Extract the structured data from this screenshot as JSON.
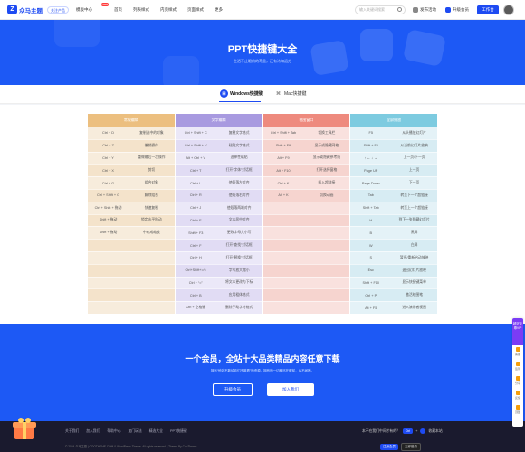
{
  "nav": {
    "logo_mark": "Z",
    "logo_text": "众马主题",
    "badge": "关注产品",
    "items": [
      {
        "label": "模板中心",
        "hot": "HOT"
      },
      {
        "label": "首页"
      },
      {
        "label": "列表样式"
      },
      {
        "label": "内页样式"
      },
      {
        "label": "页面样式"
      },
      {
        "label": "更多"
      }
    ],
    "search_placeholder": "输入关键词搜索",
    "right": [
      {
        "label": "发布活动"
      },
      {
        "label": "升级会员"
      }
    ],
    "work_button": "工作台"
  },
  "hero": {
    "title": "PPT快捷键大全",
    "subtitle": "生活不止眼前的苟且，还有诗和远方"
  },
  "tabs": [
    {
      "label": "Windows快捷键",
      "icon": "⊞"
    },
    {
      "label": "Mac快捷键",
      "icon": "⌘"
    }
  ],
  "columns": [
    {
      "title": "常规编辑",
      "color": "#ecbf7f",
      "rows": [
        [
          "Ctrl + D",
          "复制选中的对象"
        ],
        [
          "Ctrl + Z",
          "撤销操作"
        ],
        [
          "Ctrl + Y",
          "重做最后一次操作"
        ],
        [
          "Ctrl + X",
          "剪切"
        ],
        [
          "Ctrl + G",
          "组合对象"
        ],
        [
          "Ctrl + Shift + G",
          "解除组合"
        ],
        [
          "Ctrl + Shift + 拖动",
          "快速复制"
        ],
        [
          "Shift + 拖动",
          "锁定水平移动"
        ],
        [
          "Shift + 拖动",
          "中心成缩放"
        ],
        [
          "",
          ""
        ],
        [
          "",
          ""
        ],
        [
          "",
          ""
        ],
        [
          "",
          ""
        ],
        [
          "",
          ""
        ],
        [
          "",
          ""
        ]
      ]
    },
    {
      "title": "文字编辑",
      "color": "#a89ae0",
      "rows": [
        [
          "Ctrl + Shift + C",
          "复制文字格式"
        ],
        [
          "Ctrl + Shift + V",
          "粘贴文字格式"
        ],
        [
          "Alt + Ctrl + V",
          "选择性粘贴"
        ],
        [
          "Ctrl + T",
          "打开“字体”对话框"
        ],
        [
          "Ctrl + L",
          "使段落左对齐"
        ],
        [
          "Ctrl + R",
          "使段落右对齐"
        ],
        [
          "Ctrl + J",
          "使段落两端对齐"
        ],
        [
          "Ctrl + E",
          "文本居中对齐"
        ],
        [
          "Shift + F3",
          "更改字母大小写"
        ],
        [
          "Ctrl + F",
          "打开“查找”对话框"
        ],
        [
          "Ctrl + H",
          "打开“替换”对话框"
        ],
        [
          "Ctrl+Shift+>/<",
          "字号放大缩小"
        ],
        [
          "Ctrl + “=”",
          "将文本更改为下标"
        ],
        [
          "Ctrl + B",
          "应用粗体格式"
        ],
        [
          "Ctrl + 空格键",
          "删除手动字符格式"
        ]
      ]
    },
    {
      "title": "视图窗口",
      "color": "#ee8a7e",
      "rows": [
        [
          "Ctrl + Shift + Tab",
          "切换工具栏"
        ],
        [
          "Shift + F9",
          "显示或隐藏网格"
        ],
        [
          "Alt + F9",
          "显示或隐藏参考线"
        ],
        [
          "Alt + F10",
          "打开选择窗格"
        ],
        [
          "Ctrl + K",
          "插入超链接"
        ],
        [
          "Alt + K",
          "切换动画"
        ],
        [
          "",
          ""
        ],
        [
          "",
          ""
        ],
        [
          "",
          ""
        ],
        [
          "",
          ""
        ],
        [
          "",
          ""
        ],
        [
          "",
          ""
        ],
        [
          "",
          ""
        ],
        [
          "",
          ""
        ],
        [
          "",
          ""
        ]
      ]
    },
    {
      "title": "全屏播放",
      "color": "#7dcbe0",
      "rows": [
        [
          "F5",
          "从头播放幻灯片"
        ],
        [
          "Shift + F5",
          "从当前幻灯片放映"
        ],
        [
          "↑ ← ↓ →",
          "上一页/下一页"
        ],
        [
          "Page UP",
          "上一页"
        ],
        [
          "Page Down",
          "下一页"
        ],
        [
          "Tab",
          "转至下一个超链接"
        ],
        [
          "Shift + Tab",
          "转至上一个超链接"
        ],
        [
          "H",
          "到下一张隐藏幻灯片"
        ],
        [
          "B",
          "黑屏"
        ],
        [
          "W",
          "白屏"
        ],
        [
          "S",
          "暂停/重新启动放映"
        ],
        [
          "Esc",
          "退出幻灯片放映"
        ],
        [
          "Shift + F10",
          "显示快捷键菜单"
        ],
        [
          "Ctrl + P",
          "激活绘图笔"
        ],
        [
          "Alt + F5",
          "进入演讲者视图"
        ]
      ]
    }
  ],
  "cta": {
    "title": "一个会员，全站十大品类精品内容任意下载",
    "subtitle": "拥有“他站不敢给你们不敢看”的资源，拥有的一切都尽在眼前，从不间断。",
    "upgrade": "升级会员",
    "join": "加入我们"
  },
  "footer": {
    "links": [
      "关于我们",
      "加入我们",
      "帮助中心",
      "加门玩法",
      "精选大全",
      "PPT快捷键"
    ],
    "copyright": "© 2024 众马主题 | COOTHEME.COM & WordPress Theme. All rights reserved.  |  Theme By CooTheme",
    "right_text": "本不在我们中间才有的？",
    "chip": "Ctrl",
    "right_tail": "收藏本站",
    "btn1": "注册会员",
    "btn2": "立即登录"
  },
  "side": {
    "vip": "超好至尊VIP",
    "items": [
      "客服",
      "签到",
      "分享",
      "反馈",
      "顶部"
    ]
  }
}
